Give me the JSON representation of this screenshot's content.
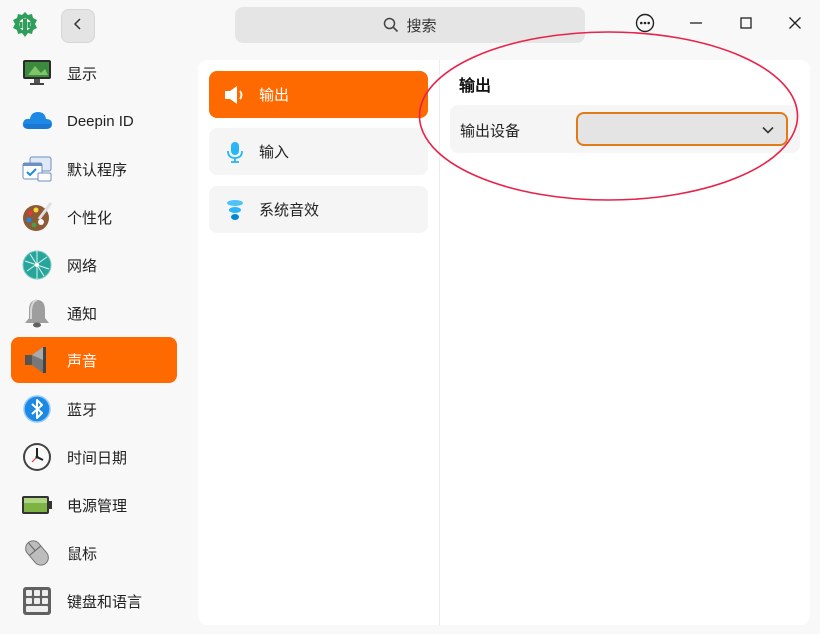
{
  "header": {
    "search_placeholder": "搜索",
    "icons": {
      "app": "settings-gear-logo-icon",
      "back": "chevron-left-icon",
      "search": "search-icon",
      "menu": "more-options-icon",
      "minimize": "minimize-icon",
      "maximize": "maximize-icon",
      "close": "close-icon"
    }
  },
  "sidebar": {
    "items": [
      {
        "label": "显示",
        "icon": "display-monitor-icon"
      },
      {
        "label": "Deepin ID",
        "icon": "cloud-icon"
      },
      {
        "label": "默认程序",
        "icon": "default-apps-icon"
      },
      {
        "label": "个性化",
        "icon": "palette-icon"
      },
      {
        "label": "网络",
        "icon": "network-globe-icon"
      },
      {
        "label": "通知",
        "icon": "bell-icon"
      },
      {
        "label": "声音",
        "icon": "speaker-icon",
        "active": true
      },
      {
        "label": "蓝牙",
        "icon": "bluetooth-icon"
      },
      {
        "label": "时间日期",
        "icon": "clock-icon"
      },
      {
        "label": "电源管理",
        "icon": "battery-icon"
      },
      {
        "label": "鼠标",
        "icon": "mouse-icon"
      },
      {
        "label": "键盘和语言",
        "icon": "keyboard-icon"
      }
    ]
  },
  "sound_nav": {
    "items": [
      {
        "label": "输出",
        "icon": "speaker-output-icon",
        "active": true
      },
      {
        "label": "输入",
        "icon": "microphone-icon"
      },
      {
        "label": "系统音效",
        "icon": "system-sound-icon"
      }
    ]
  },
  "output": {
    "title": "输出",
    "device_label": "输出设备",
    "device_value": ""
  },
  "colors": {
    "accent": "#ff6a00",
    "annotation": "#e8224a",
    "combo_border": "#e07b17"
  }
}
